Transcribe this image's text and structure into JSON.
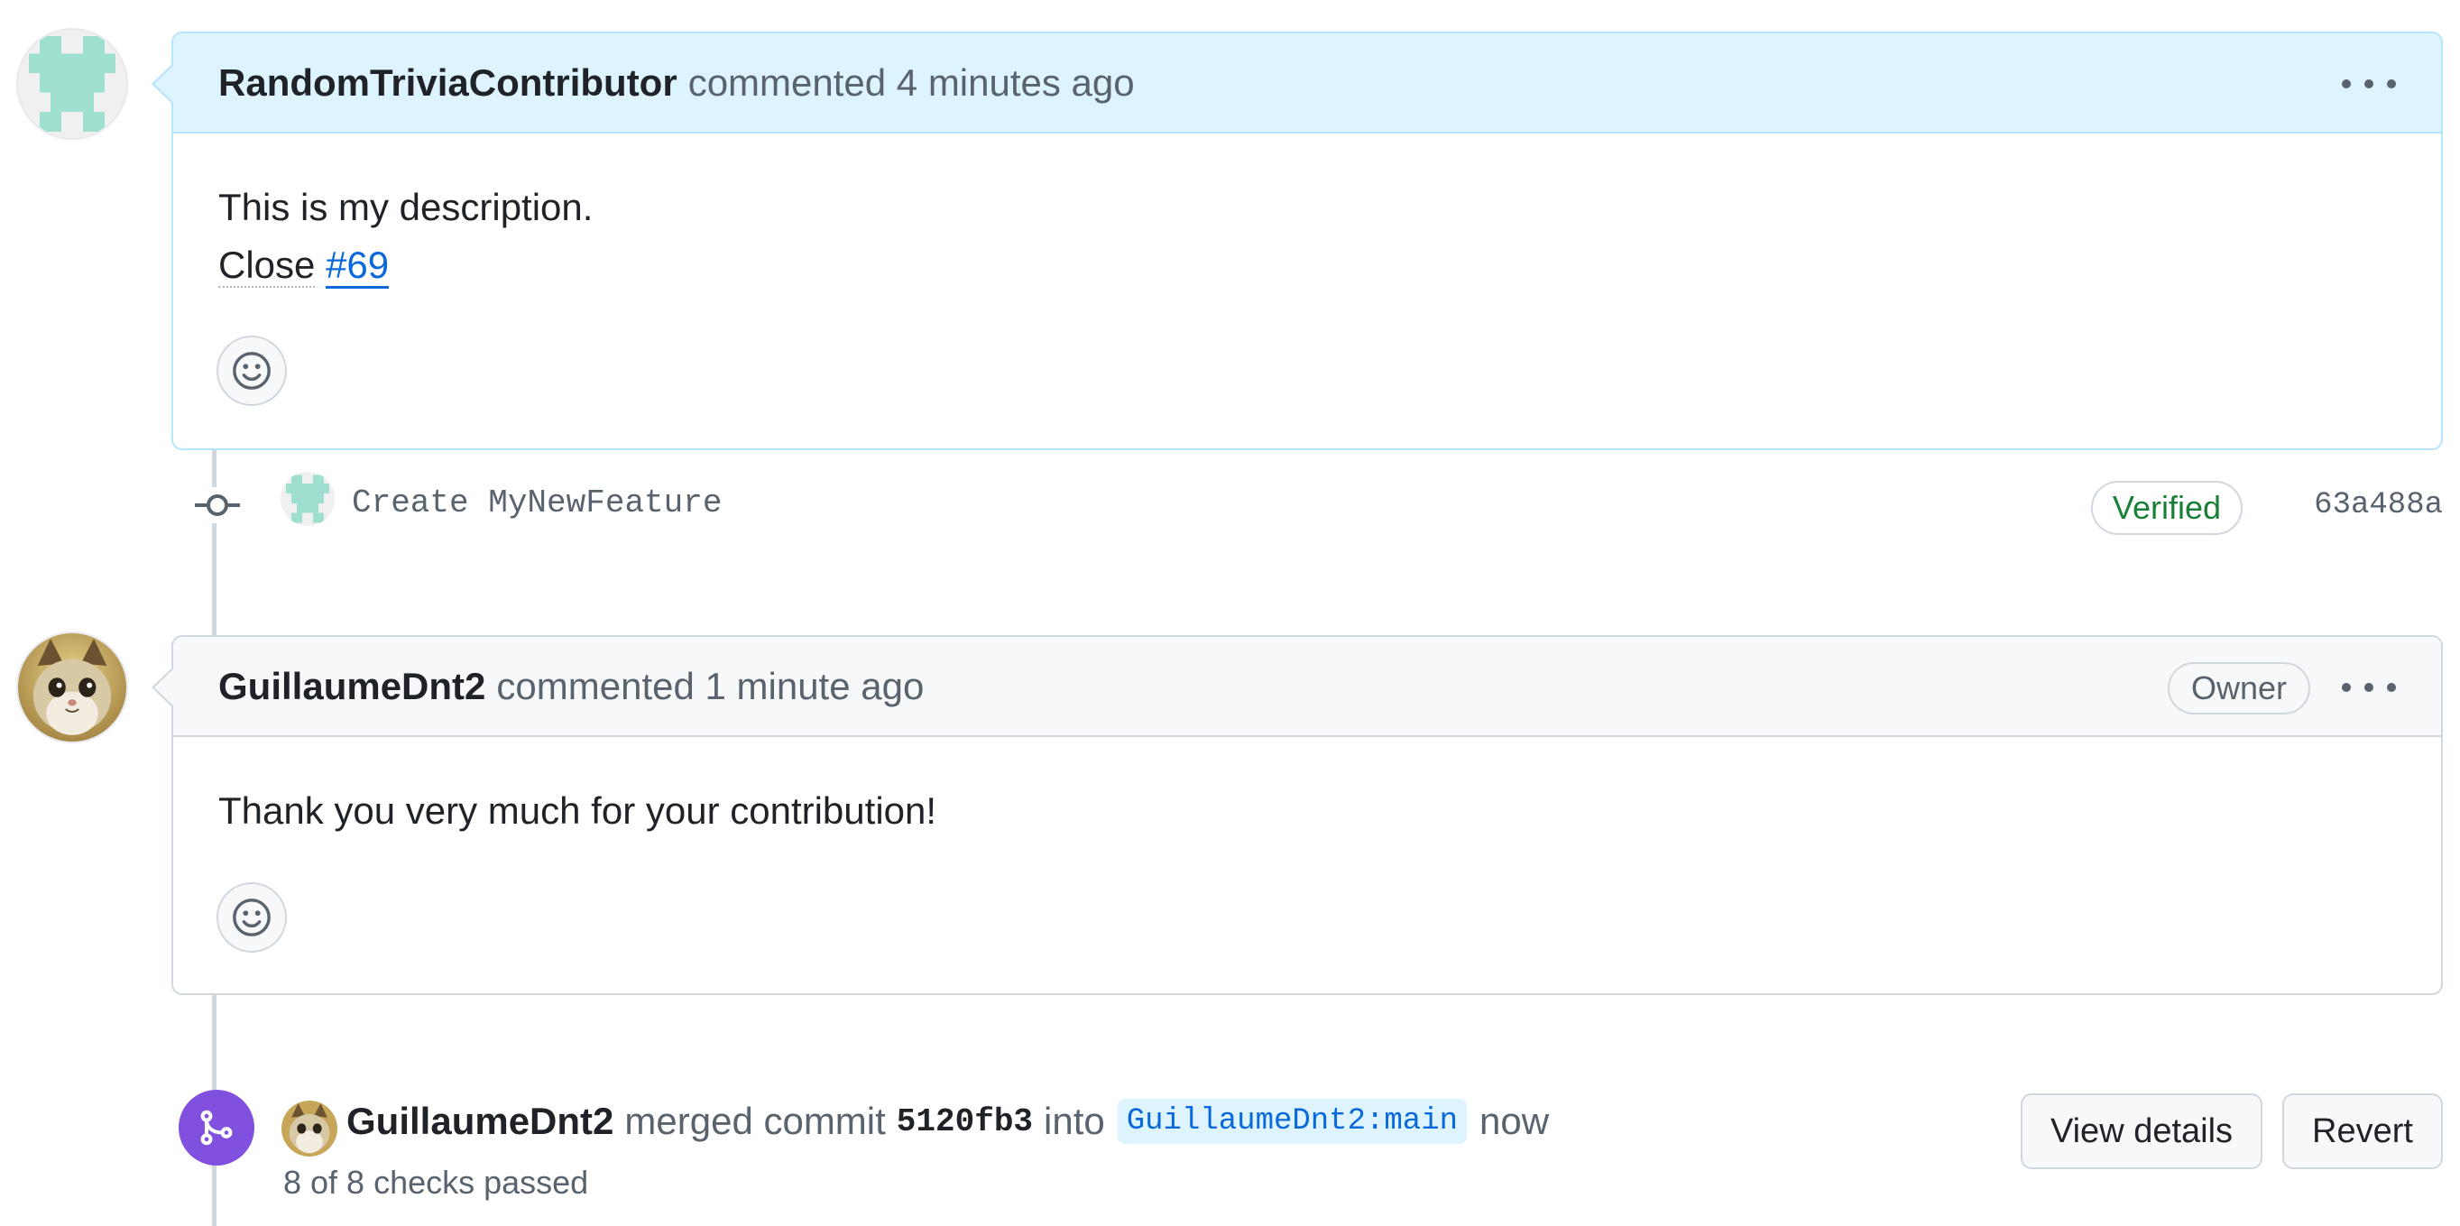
{
  "comments": [
    {
      "author": "RandomTriviaContributor",
      "action": "commented 4 minutes ago",
      "body_line1": "This is my description.",
      "close_word": "Close",
      "issue_ref": "#69",
      "avatar": "identicon-avatar"
    },
    {
      "author": "GuillaumeDnt2",
      "action": "commented 1 minute ago",
      "badge": "Owner",
      "body": "Thank you very much for your contribution!",
      "avatar": "cat-photo-avatar"
    }
  ],
  "commit": {
    "message": "Create MyNewFeature",
    "verified_label": "Verified",
    "sha": "63a488a"
  },
  "merge": {
    "author": "GuillaumeDnt2",
    "merged_text": "merged commit",
    "commit_sha": "5120fb3",
    "into_text": "into",
    "branch": "GuillaumeDnt2:main",
    "time": "now",
    "checks": "8 of 8 checks passed",
    "view_details_label": "View details",
    "revert_label": "Revert"
  },
  "colors": {
    "highlight_header": "#ddf4ff",
    "merge_purple": "#8250df",
    "link_blue": "#0969da",
    "verified_green": "#1a7f37"
  }
}
